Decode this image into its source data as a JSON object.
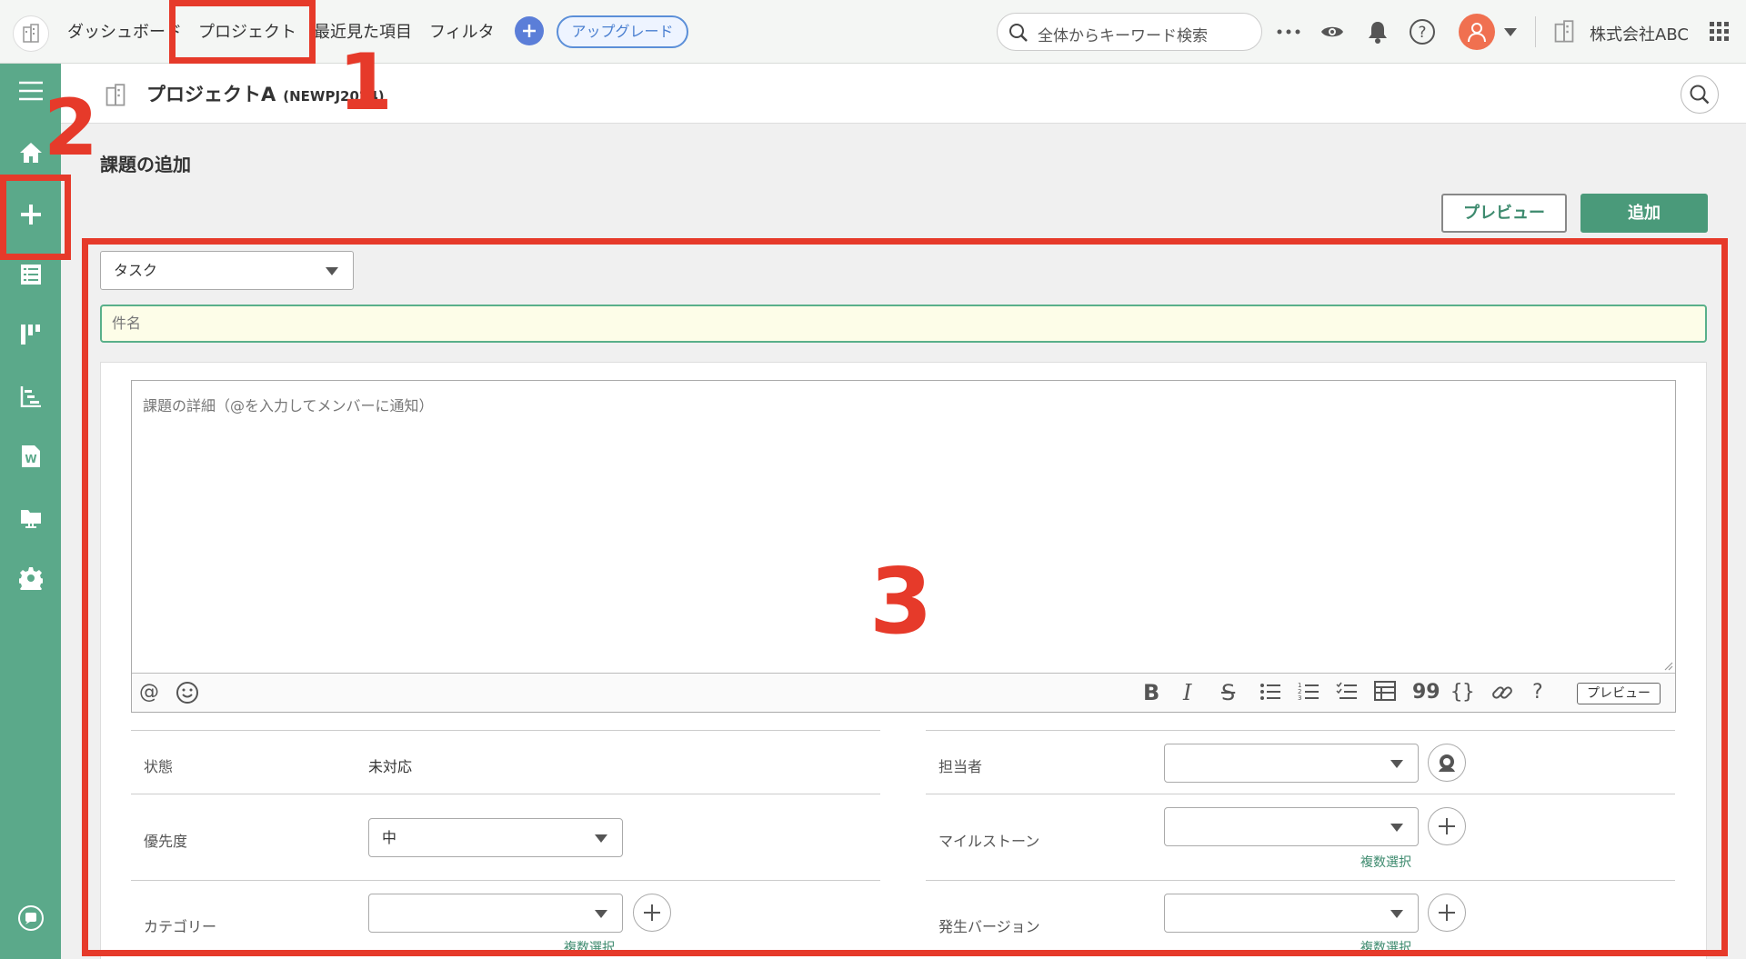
{
  "colors": {
    "accent": "#5ba98a",
    "button_green": "#4a9a7a",
    "annotation_red": "#e63a2a",
    "plus_blue": "#5b7ed8",
    "avatar": "#f07050"
  },
  "topbar": {
    "nav": [
      "ダッシュボード",
      "プロジェクト",
      "最近見た項目",
      "フィルタ"
    ],
    "upgrade": "アップグレード",
    "search_placeholder": "全体からキーワード検索",
    "company": "株式会社ABC",
    "icons": [
      "building-icon",
      "plus-icon",
      "search-icon",
      "more-icon",
      "eye-icon",
      "bell-icon",
      "help-icon",
      "user-icon",
      "chevron-down-icon",
      "apps-grid-icon"
    ]
  },
  "sidebar": {
    "items": [
      "menu-icon",
      "home-icon",
      "add-issue-icon",
      "issues-list-icon",
      "board-icon",
      "gantt-icon",
      "wiki-icon",
      "files-icon",
      "settings-icon",
      "chat-icon"
    ]
  },
  "project": {
    "name": "プロジェクトA",
    "key": "(NEWPJ2024)"
  },
  "page": {
    "title": "課題の追加",
    "preview_btn": "プレビュー",
    "add_btn": "追加"
  },
  "form": {
    "issue_type": "タスク",
    "subject_placeholder": "件名",
    "detail_placeholder": "課題の詳細（@を入力してメンバーに通知）",
    "toolbar": {
      "at": "@",
      "bold": "B",
      "italic": "I",
      "strike": "S",
      "quote": "99",
      "code": "{}",
      "help": "?",
      "preview": "プレビュー"
    },
    "fields": {
      "status_label": "状態",
      "status_value": "未対応",
      "priority_label": "優先度",
      "priority_value": "中",
      "category_label": "カテゴリー",
      "assignee_label": "担当者",
      "milestone_label": "マイルストーン",
      "version_label": "発生バージョン",
      "multi_select": "複数選択"
    }
  },
  "annotations": {
    "n1": "1",
    "n2": "2",
    "n3": "3"
  }
}
